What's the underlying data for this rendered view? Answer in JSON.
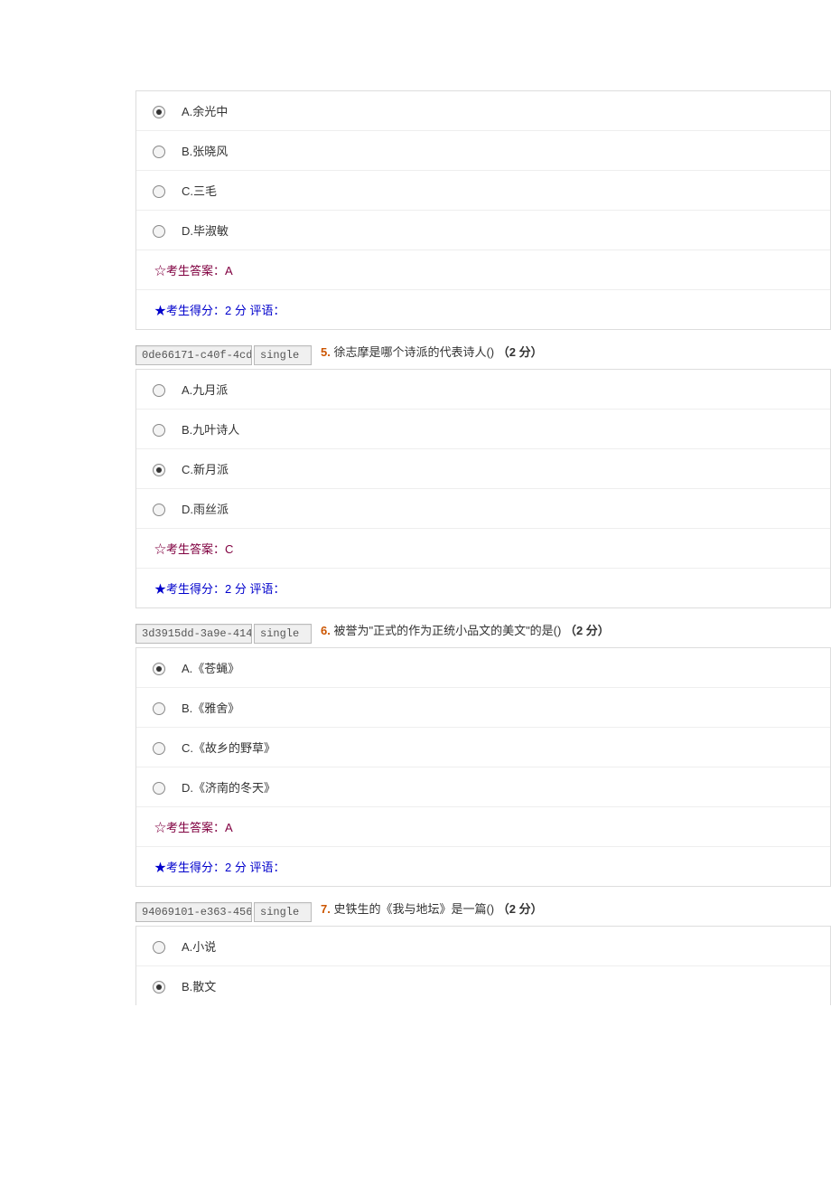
{
  "q4": {
    "options": [
      {
        "label": "A.余光中",
        "selected": true
      },
      {
        "label": "B.张晓风",
        "selected": false
      },
      {
        "label": "C.三毛",
        "selected": false
      },
      {
        "label": "D.毕淑敏",
        "selected": false
      }
    ],
    "answer": "☆考生答案：A",
    "score": "★考生得分：2 分  评语："
  },
  "q5": {
    "id": "0de66171-c40f-4cd",
    "type": "single",
    "num": "5.",
    "text": " 徐志摩是哪个诗派的代表诗人() ",
    "points": "（2 分）",
    "options": [
      {
        "label": "A.九月派",
        "selected": false
      },
      {
        "label": "B.九叶诗人",
        "selected": false
      },
      {
        "label": "C.新月派",
        "selected": true
      },
      {
        "label": "D.雨丝派",
        "selected": false
      }
    ],
    "answer": "☆考生答案：C",
    "score": "★考生得分：2 分  评语："
  },
  "q6": {
    "id": "3d3915dd-3a9e-414",
    "type": "single",
    "num": "6.",
    "text": " 被誉为\"正式的作为正统小品文的美文\"的是() ",
    "points": "（2 分）",
    "options": [
      {
        "label": "A.《苍蝇》",
        "selected": true
      },
      {
        "label": "B.《雅舍》",
        "selected": false
      },
      {
        "label": "C.《故乡的野草》",
        "selected": false
      },
      {
        "label": "D.《济南的冬天》",
        "selected": false
      }
    ],
    "answer": "☆考生答案：A",
    "score": "★考生得分：2 分  评语："
  },
  "q7": {
    "id": "94069101-e363-456",
    "type": "single",
    "num": "7.",
    "text": " 史铁生的《我与地坛》是一篇() ",
    "points": "（2 分）",
    "options": [
      {
        "label": "A.小说",
        "selected": false
      },
      {
        "label": "B.散文",
        "selected": true
      }
    ]
  }
}
